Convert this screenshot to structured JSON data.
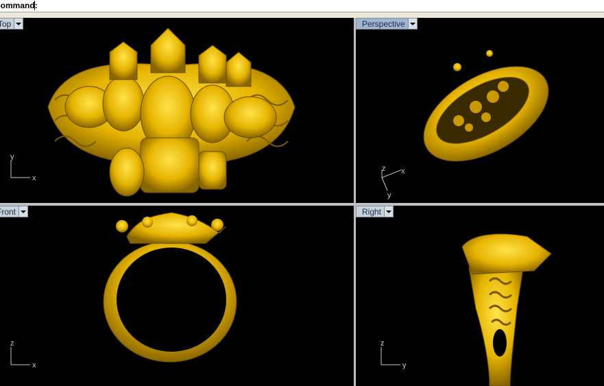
{
  "command_bar": {
    "label": "Command:",
    "value": ""
  },
  "viewports": {
    "top": {
      "label": "Top",
      "axis_a": "y",
      "axis_b": "x"
    },
    "perspective": {
      "label": "Perspective",
      "axis_a": "z",
      "axis_b": "x",
      "axis_c": "y"
    },
    "front": {
      "label": "Front",
      "axis_a": "z",
      "axis_b": "x"
    },
    "right": {
      "label": "Right",
      "axis_a": "z",
      "axis_b": "y"
    }
  },
  "colors": {
    "background": "#000000",
    "model_gold": "#f2c100",
    "model_shadow": "#a07a00"
  },
  "icons": [
    "dropdown-arrow-icon",
    "axis-icon"
  ]
}
